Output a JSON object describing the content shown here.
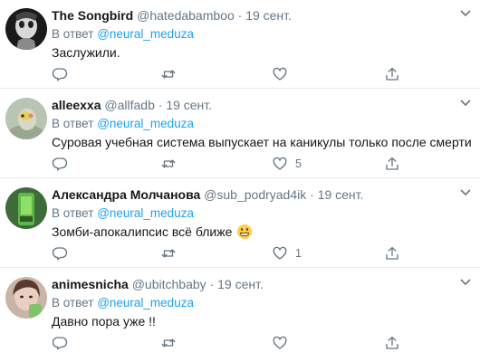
{
  "tweets": [
    {
      "name": "The Songbird",
      "handle": "@hatedabamboo",
      "dot": "·",
      "date": "19 сент.",
      "reply_prefix": "В ответ",
      "reply_mention": "@neural_meduza",
      "text": "Заслужили.",
      "likes": ""
    },
    {
      "name": "alleexxa",
      "handle": "@allfadb",
      "dot": "·",
      "date": "19 сент.",
      "reply_prefix": "В ответ",
      "reply_mention": "@neural_meduza",
      "text": "Суровая учебная система выпускает на каникулы только после смерти",
      "likes": "5"
    },
    {
      "name": "Александра Молчанова",
      "handle": "@sub_podryad4ik",
      "dot": "·",
      "date": "19 сент.",
      "reply_prefix": "В ответ",
      "reply_mention": "@neural_meduza",
      "text": "Зомби-апокалипсис всё ближе",
      "emoji": "grinning-face",
      "likes": "1"
    },
    {
      "name": "animesnicha",
      "handle": "@ubitchbaby",
      "dot": "·",
      "date": "19 сент.",
      "reply_prefix": "В ответ",
      "reply_mention": "@neural_meduza",
      "text": "Давно пора уже !!",
      "likes": ""
    }
  ],
  "icons": {
    "reply": "reply-icon",
    "retweet": "retweet-icon",
    "like": "heart-icon",
    "share": "share-icon",
    "more": "chevron-down-icon"
  },
  "colors": {
    "accent": "#1da1f2",
    "secondary_text": "#657786",
    "divider": "#e6ecf0"
  }
}
